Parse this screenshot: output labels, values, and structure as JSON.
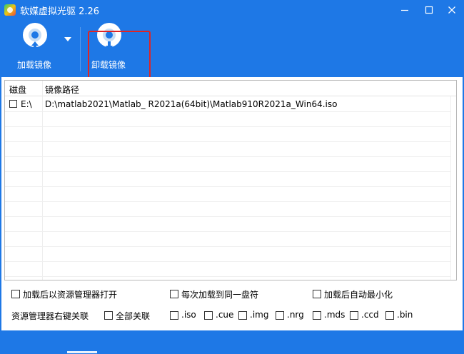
{
  "window": {
    "title": "软媒虚拟光驱 2.26",
    "accent_color": "#1e78e6",
    "highlight_color": "#e02424"
  },
  "toolbar": {
    "mount_label": "加载镜像",
    "unmount_label": "卸载镜像",
    "mount_icon": "disc-mount-icon",
    "unmount_icon": "disc-unmount-icon"
  },
  "table": {
    "columns": [
      "磁盘",
      "镜像路径"
    ],
    "rows": [
      {
        "drive": "E:\\",
        "path": "D:\\matlab2021\\Matlab_ R2021a(64bit)\\Matlab910R2021a_Win64.iso",
        "checked": false
      }
    ]
  },
  "options": {
    "open_explorer_after_mount": "加载后以资源管理器打开",
    "same_drive_each_time": "每次加载到同一盘符",
    "auto_minimize": "加载后自动最小化",
    "context_menu_label": "资源管理器右键关联",
    "associate_all": "全部关联",
    "extensions": [
      ".iso",
      ".cue",
      ".img",
      ".nrg",
      ".mds",
      ".ccd",
      ".bin"
    ]
  }
}
